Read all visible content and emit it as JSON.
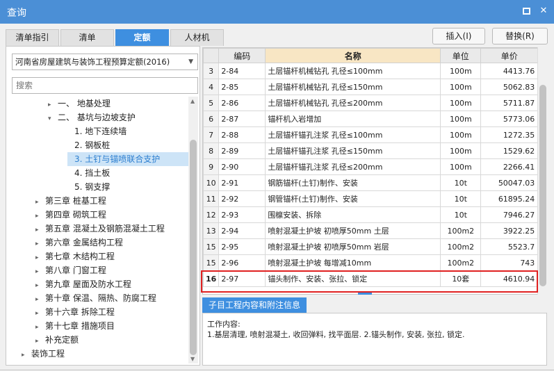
{
  "window": {
    "title": "查询"
  },
  "tabs": [
    {
      "label": "清单指引",
      "active": false
    },
    {
      "label": "清单",
      "active": false
    },
    {
      "label": "定额",
      "active": true
    },
    {
      "label": "人材机",
      "active": false
    }
  ],
  "actions": {
    "insert_label": "插入(I)",
    "replace_label": "替换(R)"
  },
  "left": {
    "quota_book": "河南省房屋建筑与装饰工程预算定额(2016)",
    "search_placeholder": "搜索",
    "tree": [
      {
        "label": "一、 地基处理",
        "caret": "▸"
      },
      {
        "label": "二、 基坑与边坡支护",
        "caret": "▾"
      },
      {
        "label": "1. 地下连续墙",
        "caret": ""
      },
      {
        "label": "2. 钢板桩",
        "caret": ""
      },
      {
        "label": "3. 土钉与锚喷联合支护",
        "caret": "",
        "selected": true
      },
      {
        "label": "4. 挡土板",
        "caret": ""
      },
      {
        "label": "5. 钢支撑",
        "caret": ""
      },
      {
        "label": "第三章 桩基工程",
        "caret": "▸"
      },
      {
        "label": "第四章 砌筑工程",
        "caret": "▸"
      },
      {
        "label": "第五章 混凝土及钢筋混凝土工程",
        "caret": "▸"
      },
      {
        "label": "第六章 金属结构工程",
        "caret": "▸"
      },
      {
        "label": "第七章 木结构工程",
        "caret": "▸"
      },
      {
        "label": "第八章 门窗工程",
        "caret": "▸"
      },
      {
        "label": "第九章 屋面及防水工程",
        "caret": "▸"
      },
      {
        "label": "第十章 保温、隔热、防腐工程",
        "caret": "▸"
      },
      {
        "label": "第十六章 拆除工程",
        "caret": "▸"
      },
      {
        "label": "第十七章 措施项目",
        "caret": "▸"
      },
      {
        "label": "补充定额",
        "caret": "▸"
      },
      {
        "label": "装饰工程",
        "caret": "▸"
      }
    ]
  },
  "grid": {
    "headers": {
      "code": "编码",
      "name": "名称",
      "unit": "单位",
      "price": "单价"
    },
    "rows": [
      {
        "idx": "3",
        "code": "2-84",
        "name": "土层锚杆机械钻孔 孔径≤100mm",
        "unit": "100m",
        "price": "4413.76"
      },
      {
        "idx": "4",
        "code": "2-85",
        "name": "土层锚杆机械钻孔 孔径≤150mm",
        "unit": "100m",
        "price": "5062.83"
      },
      {
        "idx": "5",
        "code": "2-86",
        "name": "土层锚杆机械钻孔 孔径≤200mm",
        "unit": "100m",
        "price": "5711.87"
      },
      {
        "idx": "6",
        "code": "2-87",
        "name": "锚杆机入岩增加",
        "unit": "100m",
        "price": "5773.06"
      },
      {
        "idx": "7",
        "code": "2-88",
        "name": "土层锚杆锚孔注浆 孔径≤100mm",
        "unit": "100m",
        "price": "1272.35"
      },
      {
        "idx": "8",
        "code": "2-89",
        "name": "土层锚杆锚孔注浆 孔径≤150mm",
        "unit": "100m",
        "price": "1529.62"
      },
      {
        "idx": "9",
        "code": "2-90",
        "name": "土层锚杆锚孔注浆 孔径≤200mm",
        "unit": "100m",
        "price": "2266.41"
      },
      {
        "idx": "10",
        "code": "2-91",
        "name": "钢筋锚杆(土钉)制作、安装",
        "unit": "10t",
        "price": "50047.03"
      },
      {
        "idx": "11",
        "code": "2-92",
        "name": "钢管锚杆(土钉)制作、安装",
        "unit": "10t",
        "price": "61895.24"
      },
      {
        "idx": "12",
        "code": "2-93",
        "name": "围檩安装、拆除",
        "unit": "10t",
        "price": "7946.27"
      },
      {
        "idx": "13",
        "code": "2-94",
        "name": "喷射混凝土护坡 初喷厚50mm 土层",
        "unit": "100m2",
        "price": "3922.25"
      },
      {
        "idx": "15",
        "code": "2-95",
        "name": "喷射混凝土护坡 初喷厚50mm 岩层",
        "unit": "100m2",
        "price": "5523.7"
      },
      {
        "idx": "15",
        "code": "2-96",
        "name": "喷射混凝土护坡 每增减10mm",
        "unit": "100m2",
        "price": "743"
      },
      {
        "idx": "16",
        "code": "2-97",
        "name": "锚头制作、安装、张拉、锁定",
        "unit": "10套",
        "price": "4610.94",
        "current": true
      }
    ]
  },
  "info": {
    "tab_label": "子目工程内容和附注信息",
    "line1": "工作内容:",
    "line2": "1.基层清理, 喷射混凝土, 收回弹料, 找平面层. 2.锚头制作, 安装, 张拉, 锁定."
  }
}
